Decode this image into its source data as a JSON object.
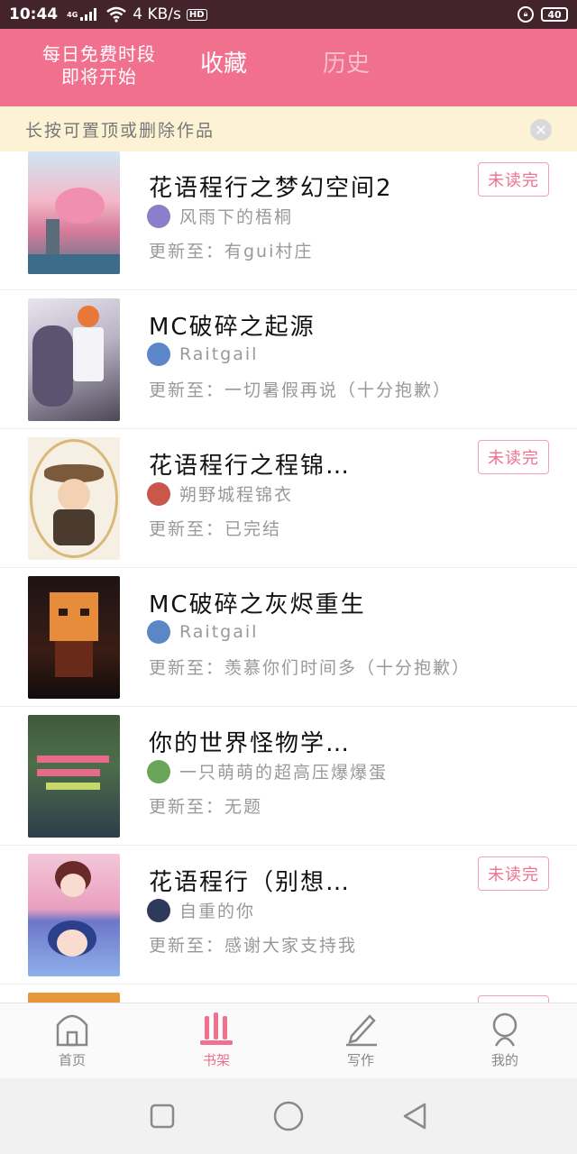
{
  "status_bar": {
    "time": "10:44",
    "network": "4G",
    "speed": "4 KB/s",
    "hd": "HD",
    "battery": "40"
  },
  "header": {
    "tab_free_line1": "每日免费时段",
    "tab_free_line2": "即将开始",
    "tab_collect": "收藏",
    "tab_history": "历史"
  },
  "notice": {
    "text": "长按可置顶或删除作品"
  },
  "books": [
    {
      "title": "花语程行之梦幻空间2",
      "author": "风雨下的梧桐",
      "update": "更新至：有gui村庄",
      "badge": "未读完",
      "author_color": "#8a7fc8"
    },
    {
      "title": "MC破碎之起源",
      "author": "Raitgail",
      "update": "更新至：一切暑假再说（十分抱歉）",
      "badge": "",
      "author_color": "#5b86c8"
    },
    {
      "title": "花语程行之程锦…",
      "author": "朔野城程锦衣",
      "update": "更新至：已完结",
      "badge": "未读完",
      "author_color": "#c9584a"
    },
    {
      "title": "MC破碎之灰烬重生",
      "author": "Raitgail",
      "update": "更新至：羡慕你们时间多（十分抱歉）",
      "badge": "",
      "author_color": "#5b86c8"
    },
    {
      "title": "你的世界怪物学…",
      "author": "一只萌萌的超高压爆爆蛋",
      "update": "更新至：无题",
      "badge": "",
      "author_color": "#6aa55a"
    },
    {
      "title": "花语程行（别想…",
      "author": "自重的你",
      "update": "更新至：感谢大家支持我",
      "badge": "未读完",
      "author_color": "#2d3a5a"
    },
    {
      "title": "",
      "author": "",
      "update": "",
      "badge": "",
      "author_color": "#cccccc"
    }
  ],
  "bottom_nav": {
    "home": "首页",
    "shelf": "书架",
    "write": "写作",
    "mine": "我的"
  },
  "colors": {
    "brand_pink": "#f0708e",
    "status_bar": "#43242c",
    "notice_bg": "#fdf2d4"
  }
}
